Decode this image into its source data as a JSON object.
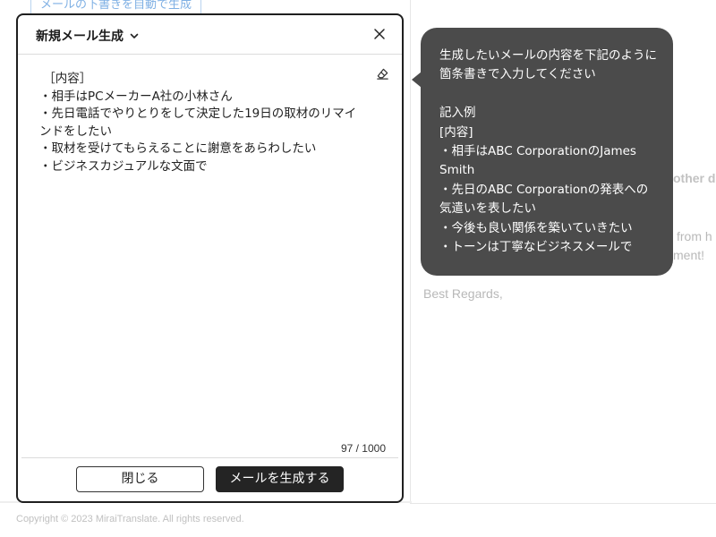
{
  "background": {
    "top_link_label": "メールの下書きを自動で生成",
    "fragment_other": "other d",
    "fragment_from": "from h",
    "fragment_ment": "ment!",
    "closing": "Best Regards,",
    "copyright": "Copyright © 2023 MiraiTranslate. All rights reserved."
  },
  "modal": {
    "title": "新規メール生成",
    "close_icon": "close-icon",
    "dropdown_icon": "chevron-down-icon",
    "eraser_icon": "eraser-icon",
    "content": " ［内容］\n・相手はPCメーカーA社の小林さん\n・先日電話でやりとりをして決定した19日の取材のリマインドをしたい\n・取材を受けてもらえることに謝意をあらわしたい\n・ビジネスカジュアルな文面で",
    "char_count": "97 / 1000",
    "close_label": "閉じる",
    "generate_label": "メールを生成する"
  },
  "tooltip": {
    "text": "生成したいメールの内容を下記のように箇条書きで入力してください\n\n記入例\n[内容]\n・相手はABC CorporationのJames Smith\n・先日のABC Corporationの発表への気遣いを表したい\n・今後も良い関係を築いていきたい\n・トーンは丁寧なビジネスメールで"
  },
  "colors": {
    "modal_border": "#1f1f1f",
    "tooltip_bg": "#4b4b4b",
    "primary_button": "#242424",
    "link_blue": "#7fb0e4"
  }
}
